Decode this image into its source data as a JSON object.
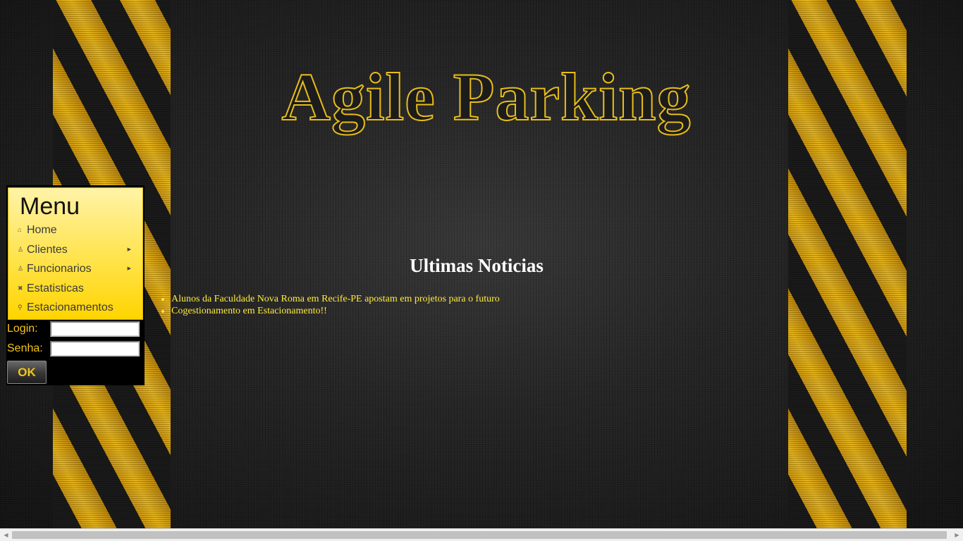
{
  "header": {
    "title": "Agile Parking"
  },
  "menu": {
    "title": "Menu",
    "items": [
      {
        "label": "Home",
        "icon": "home-icon",
        "glyph": "⌂",
        "has_submenu": false
      },
      {
        "label": "Clientes",
        "icon": "user-icon",
        "glyph": "♙",
        "has_submenu": true
      },
      {
        "label": "Funcionarios",
        "icon": "user-icon",
        "glyph": "♙",
        "has_submenu": true
      },
      {
        "label": "Estatisticas",
        "icon": "wrench-icon",
        "glyph": "✖",
        "has_submenu": false
      },
      {
        "label": "Estacionamentos",
        "icon": "search-icon",
        "glyph": "⚲",
        "has_submenu": false
      }
    ],
    "arrow_glyph": "▶"
  },
  "login": {
    "login_label": "Login:",
    "login_value": "",
    "password_label": "Senha:",
    "password_value": "",
    "submit_label": "OK"
  },
  "news": {
    "title": "Ultimas Noticias",
    "items": [
      "Alunos da Faculdade Nova Roma em Recife-PE apostam em projetos para o futuro",
      "Cogestionamento em Estacionamento!!"
    ]
  },
  "scrollbar": {
    "left_glyph": "◀",
    "right_glyph": "▶"
  },
  "colors": {
    "accent": "#f5c518",
    "menu_gradient_top": "#fff3a8",
    "menu_gradient_bottom": "#ffd400",
    "news_text": "#ffeb3b",
    "background": "#1b1b1b"
  }
}
